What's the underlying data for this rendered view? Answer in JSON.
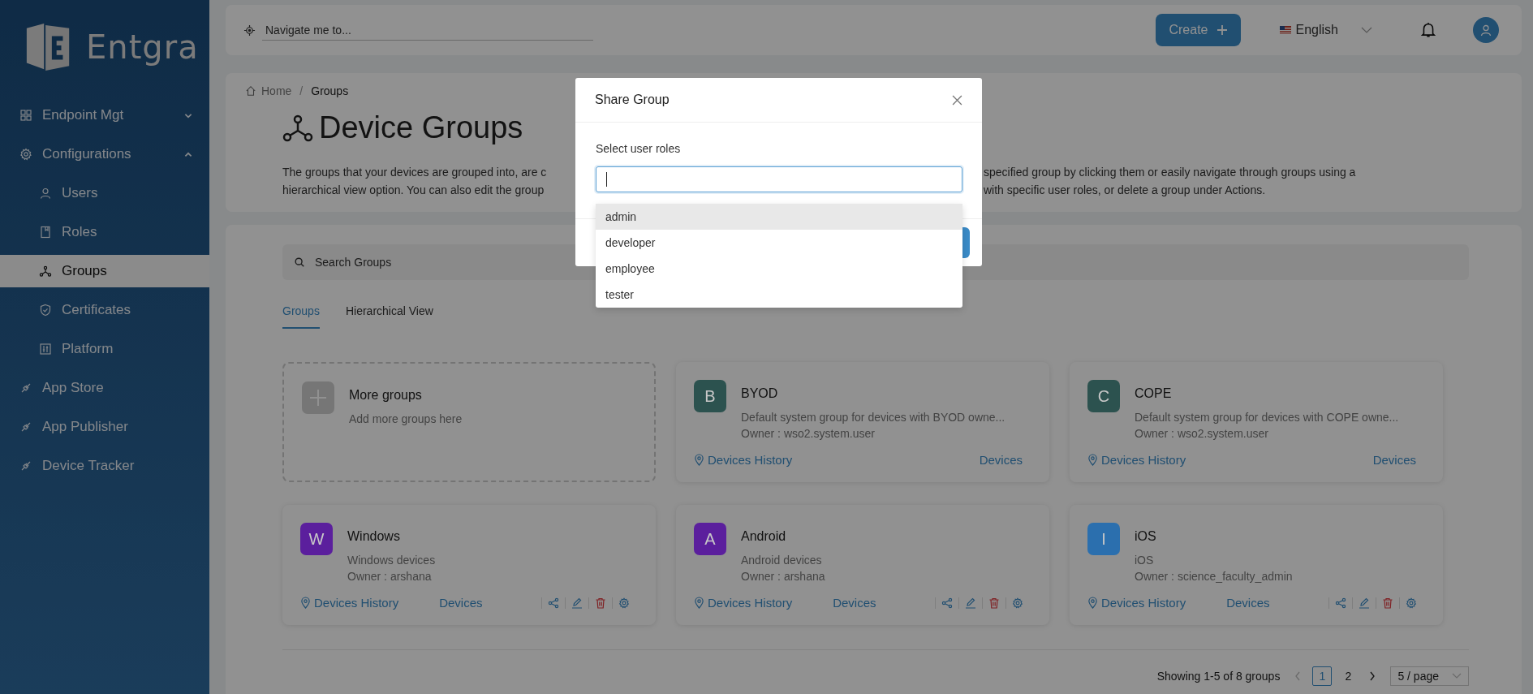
{
  "sidebar": {
    "logo": "Entgra",
    "items": [
      {
        "label": "Endpoint Mgt",
        "expanded": false,
        "selected": false
      },
      {
        "label": "Configurations",
        "expanded": true,
        "selected": false,
        "children": [
          {
            "label": "Users",
            "selected": false
          },
          {
            "label": "Roles",
            "selected": false
          },
          {
            "label": "Groups",
            "selected": true
          },
          {
            "label": "Certificates",
            "selected": false
          },
          {
            "label": "Platform",
            "selected": false
          }
        ]
      },
      {
        "label": "App Store",
        "selected": false
      },
      {
        "label": "App Publisher",
        "selected": false
      },
      {
        "label": "Device Tracker",
        "selected": false
      }
    ]
  },
  "topbar": {
    "navigate": {
      "placeholder": "Navigate me to..."
    },
    "create": "Create",
    "language": "English"
  },
  "breadcrumb": {
    "home": "Home",
    "separator": "/",
    "current": "Groups"
  },
  "title": "Device Groups",
  "description": [
    {
      "left": "The groups that your devices are grouped into, are c",
      "right": "specified group by clicking them or easily navigate through groups using a"
    },
    {
      "left": "hierarchical view option. You can also edit the group",
      "right": "with specific user roles, or delete a group under Actions."
    }
  ],
  "search": {
    "placeholder": "Search Groups"
  },
  "tabs": [
    {
      "label": "Groups",
      "selected": true
    },
    {
      "label": "Hierarchical View",
      "selected": false
    }
  ],
  "cards": [
    {
      "kind": "add",
      "title": "More groups",
      "subtitle": "Add more groups here"
    },
    {
      "kind": "group",
      "letter": "B",
      "color": "#2c524f",
      "title": "BYOD",
      "description": "Default system group for devices with BYOD owne...",
      "owner": "Owner : wso2.system.user",
      "history": "Devices History",
      "devices": "Devices",
      "actions": false
    },
    {
      "kind": "group",
      "letter": "C",
      "color": "#2c524f",
      "title": "COPE",
      "description": "Default system group for devices with COPE owne...",
      "owner": "Owner : wso2.system.user",
      "history": "Devices History",
      "devices": "Devices",
      "actions": false
    },
    {
      "kind": "group",
      "letter": "W",
      "color": "#5b1f9d",
      "title": "Windows",
      "description": "Windows devices",
      "owner": "Owner : arshana",
      "history": "Devices History",
      "devices": "Devices",
      "actions": true
    },
    {
      "kind": "group",
      "letter": "A",
      "color": "#5b1f9d",
      "title": "Android",
      "description": "Android devices",
      "owner": "Owner : arshana",
      "history": "Devices History",
      "devices": "Devices",
      "actions": true
    },
    {
      "kind": "group",
      "letter": "I",
      "color": "#2b6fae",
      "title": "iOS",
      "description": "iOS",
      "owner": "Owner : science_faculty_admin",
      "history": "Devices History",
      "devices": "Devices",
      "actions": true
    }
  ],
  "pagination": {
    "summary": "Showing 1-5 of 8 groups",
    "pages": [
      {
        "label": "1",
        "selected": true
      },
      {
        "label": "2",
        "selected": false
      }
    ],
    "page_size": "5 / page"
  },
  "modal": {
    "title": "Share Group",
    "label": "Select user roles",
    "options": [
      {
        "label": "admin",
        "selected": true
      },
      {
        "label": "developer",
        "selected": false
      },
      {
        "label": "employee",
        "selected": false
      },
      {
        "label": "tester",
        "selected": false
      }
    ]
  }
}
